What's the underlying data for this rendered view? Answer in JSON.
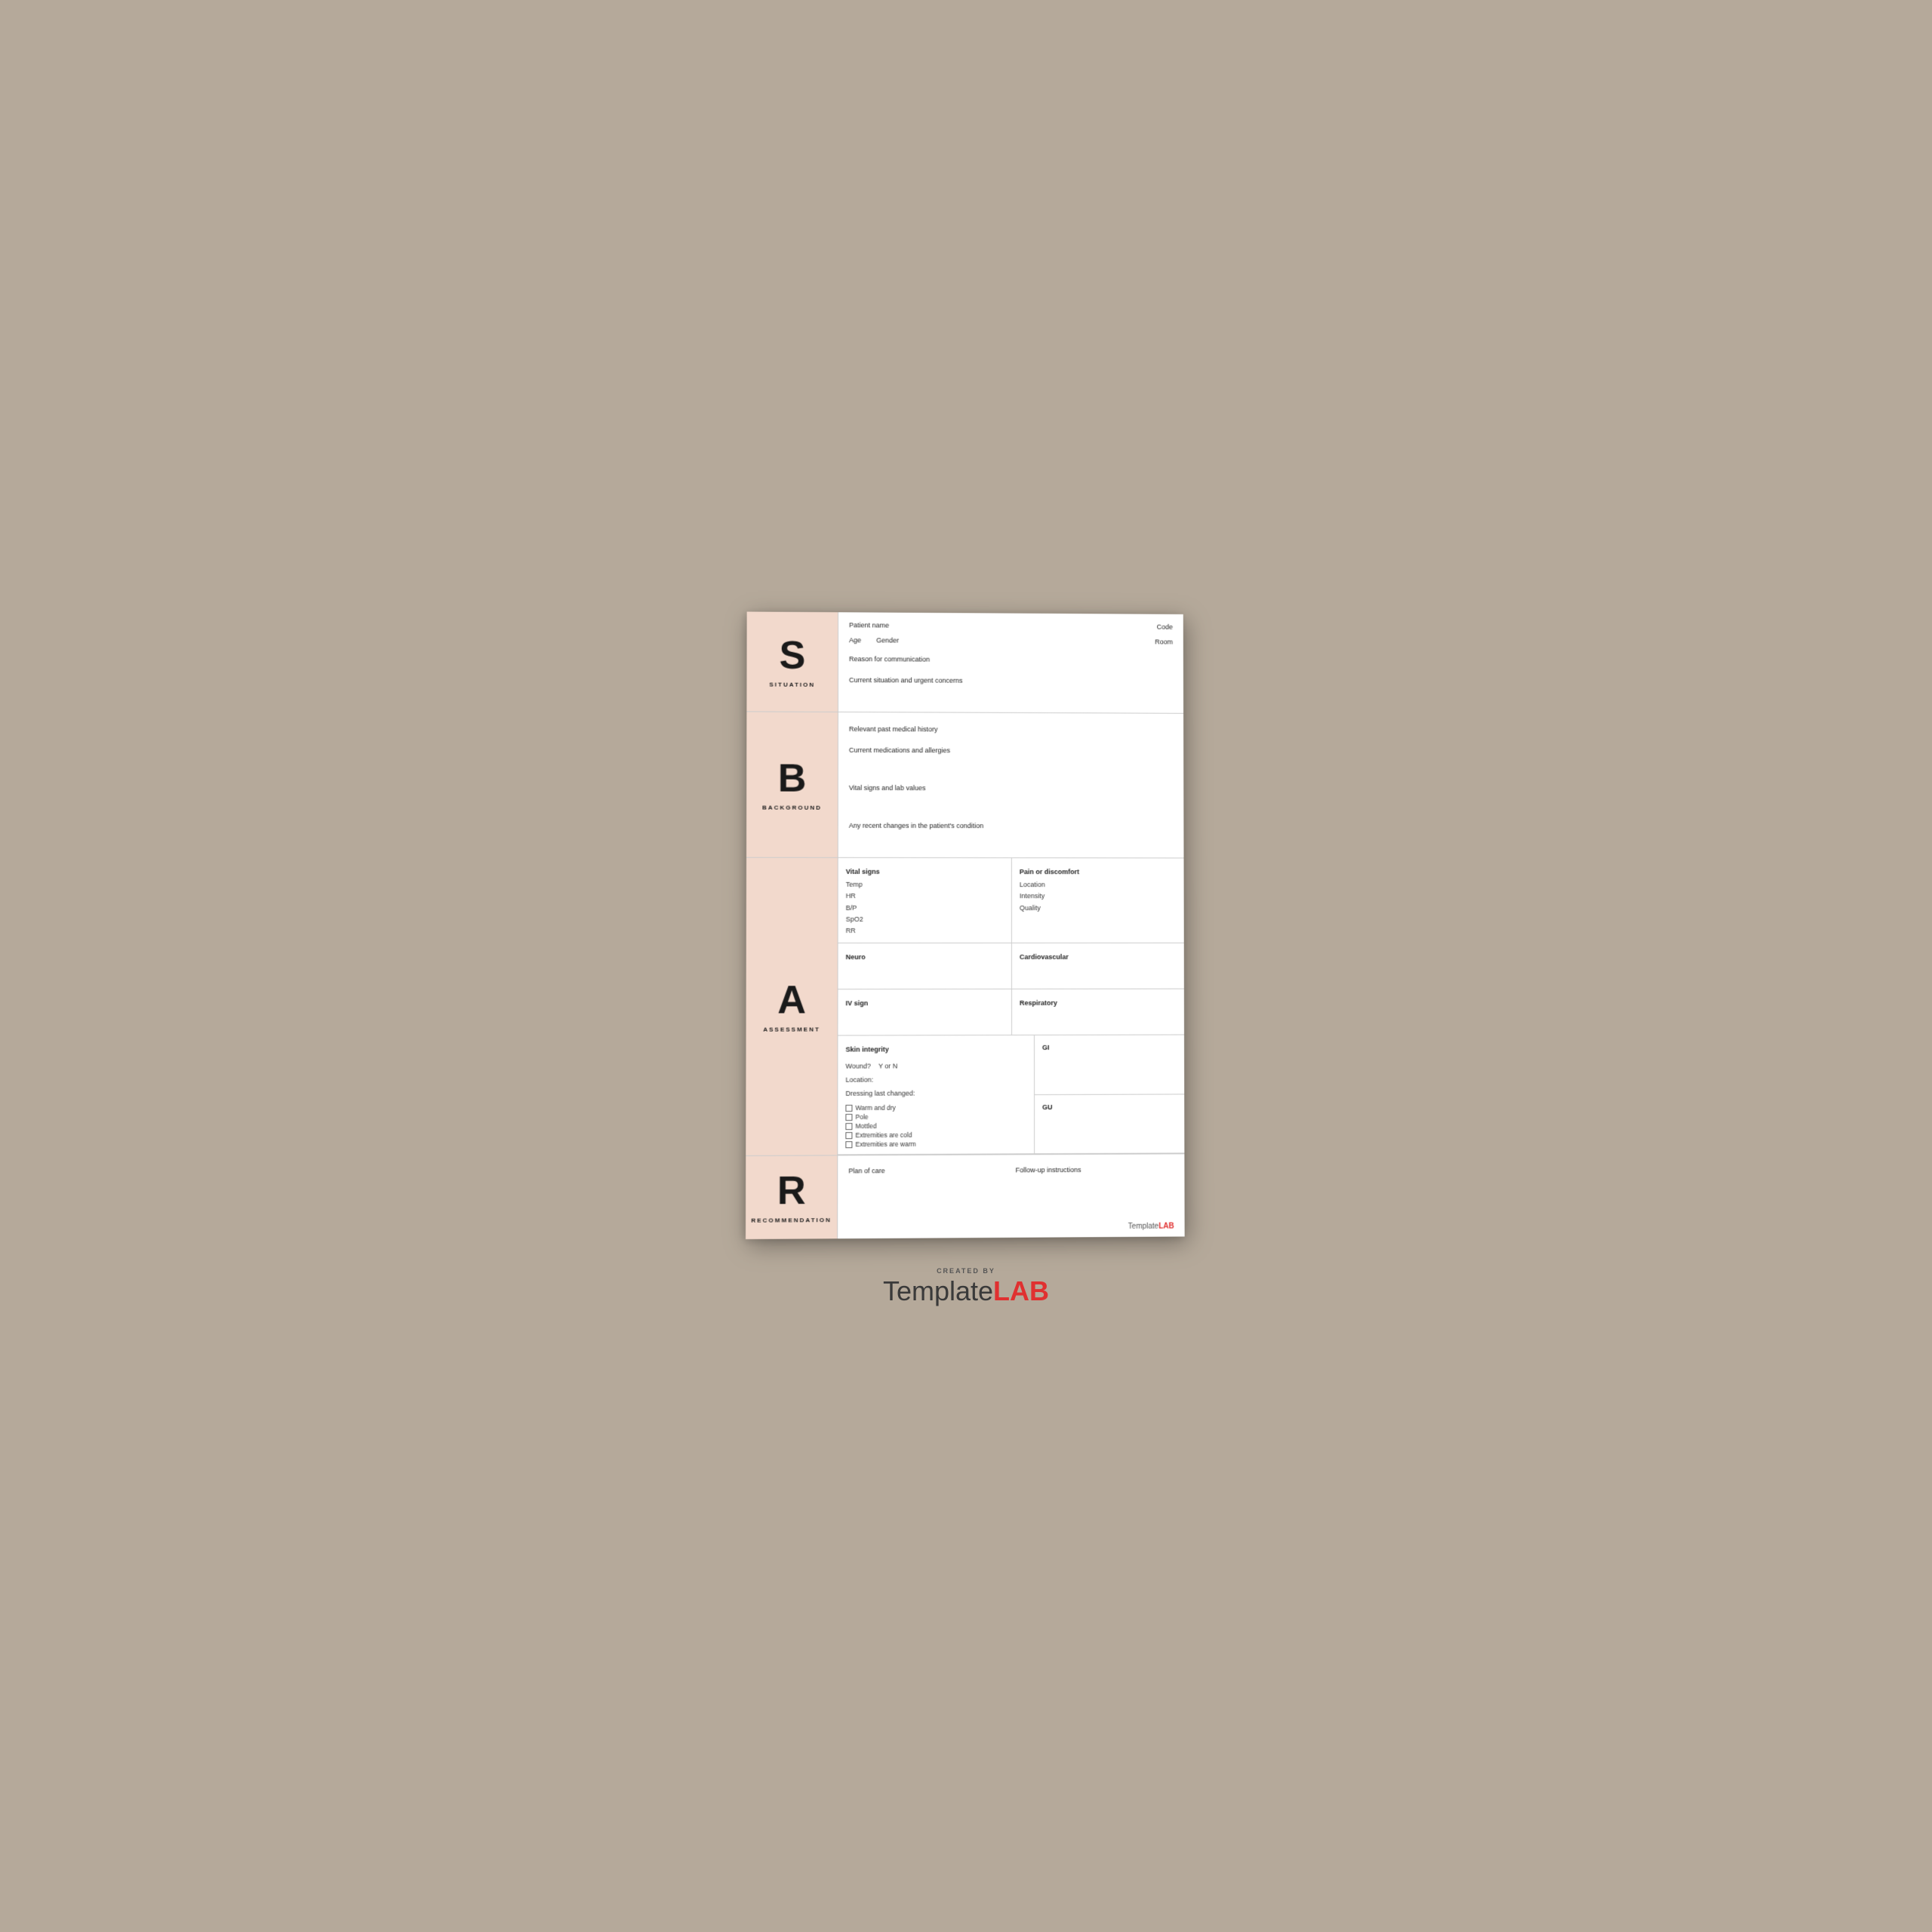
{
  "situation": {
    "letter": "S",
    "label": "SITUATION",
    "fields": {
      "patient_name": "Patient name",
      "code": "Code",
      "age": "Age",
      "gender": "Gender",
      "room": "Room",
      "reason": "Reason for communication",
      "current_situation": "Current situation and urgent concerns"
    }
  },
  "background": {
    "letter": "B",
    "label": "BACKGROUND",
    "fields": {
      "past_history": "Relevant past medical history",
      "medications": "Current medications and allergies",
      "vital_signs": "Vital signs and lab values",
      "recent_changes": "Any recent changes in the patient's condition"
    }
  },
  "assessment": {
    "letter": "A",
    "label": "ASSESSMENT",
    "vital_signs": {
      "header": "Vital signs",
      "items": [
        "Temp",
        "HR",
        "B/P",
        "SpO2",
        "RR"
      ]
    },
    "pain": {
      "header": "Pain or discomfort",
      "items": [
        "Location",
        "Intensity",
        "Quality"
      ]
    },
    "neuro": "Neuro",
    "cardiovascular": "Cardiovascular",
    "iv_sign": "IV sign",
    "respiratory": "Respiratory",
    "skin_integrity": {
      "label": "Skin integrity",
      "wound_label": "Wound?",
      "wound_yn": "Y or N",
      "location_label": "Location:",
      "dressing_label": "Dressing last changed:",
      "checkboxes": [
        "Warm and dry",
        "Pole",
        "Mottled",
        "Extremities are cold",
        "Extremities are warm"
      ]
    },
    "gi": "GI",
    "gu": "GU"
  },
  "recommendation": {
    "letter": "R",
    "label": "RECOMMENDATION",
    "plan_label": "Plan of care",
    "followup_label": "Follow-up instructions"
  },
  "branding": {
    "template_logo": "Template",
    "lab_logo": "LAB",
    "footer_created": "CREATED BY",
    "footer_template": "Template",
    "footer_lab": "LAB"
  }
}
